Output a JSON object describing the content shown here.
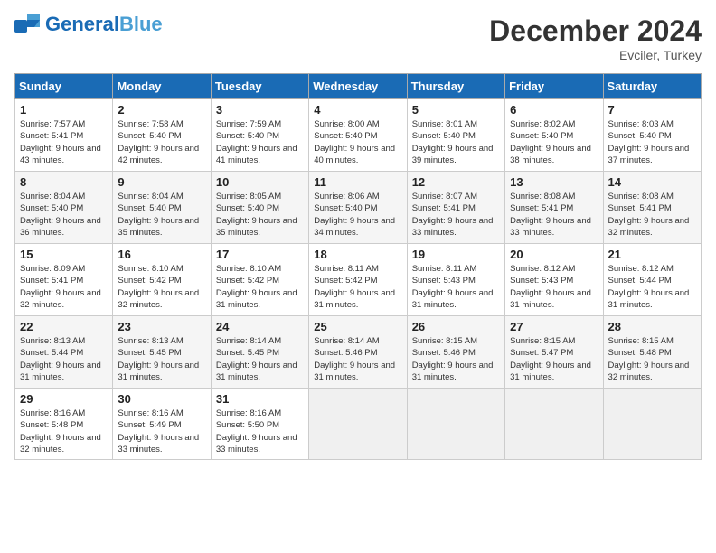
{
  "header": {
    "logo_general": "General",
    "logo_blue": "Blue",
    "month_title": "December 2024",
    "location": "Evciler, Turkey"
  },
  "weekdays": [
    "Sunday",
    "Monday",
    "Tuesday",
    "Wednesday",
    "Thursday",
    "Friday",
    "Saturday"
  ],
  "weeks": [
    [
      {
        "day": "1",
        "sunrise": "7:57 AM",
        "sunset": "5:41 PM",
        "daylight": "9 hours and 43 minutes."
      },
      {
        "day": "2",
        "sunrise": "7:58 AM",
        "sunset": "5:40 PM",
        "daylight": "9 hours and 42 minutes."
      },
      {
        "day": "3",
        "sunrise": "7:59 AM",
        "sunset": "5:40 PM",
        "daylight": "9 hours and 41 minutes."
      },
      {
        "day": "4",
        "sunrise": "8:00 AM",
        "sunset": "5:40 PM",
        "daylight": "9 hours and 40 minutes."
      },
      {
        "day": "5",
        "sunrise": "8:01 AM",
        "sunset": "5:40 PM",
        "daylight": "9 hours and 39 minutes."
      },
      {
        "day": "6",
        "sunrise": "8:02 AM",
        "sunset": "5:40 PM",
        "daylight": "9 hours and 38 minutes."
      },
      {
        "day": "7",
        "sunrise": "8:03 AM",
        "sunset": "5:40 PM",
        "daylight": "9 hours and 37 minutes."
      }
    ],
    [
      {
        "day": "8",
        "sunrise": "8:04 AM",
        "sunset": "5:40 PM",
        "daylight": "9 hours and 36 minutes."
      },
      {
        "day": "9",
        "sunrise": "8:04 AM",
        "sunset": "5:40 PM",
        "daylight": "9 hours and 35 minutes."
      },
      {
        "day": "10",
        "sunrise": "8:05 AM",
        "sunset": "5:40 PM",
        "daylight": "9 hours and 35 minutes."
      },
      {
        "day": "11",
        "sunrise": "8:06 AM",
        "sunset": "5:40 PM",
        "daylight": "9 hours and 34 minutes."
      },
      {
        "day": "12",
        "sunrise": "8:07 AM",
        "sunset": "5:41 PM",
        "daylight": "9 hours and 33 minutes."
      },
      {
        "day": "13",
        "sunrise": "8:08 AM",
        "sunset": "5:41 PM",
        "daylight": "9 hours and 33 minutes."
      },
      {
        "day": "14",
        "sunrise": "8:08 AM",
        "sunset": "5:41 PM",
        "daylight": "9 hours and 32 minutes."
      }
    ],
    [
      {
        "day": "15",
        "sunrise": "8:09 AM",
        "sunset": "5:41 PM",
        "daylight": "9 hours and 32 minutes."
      },
      {
        "day": "16",
        "sunrise": "8:10 AM",
        "sunset": "5:42 PM",
        "daylight": "9 hours and 32 minutes."
      },
      {
        "day": "17",
        "sunrise": "8:10 AM",
        "sunset": "5:42 PM",
        "daylight": "9 hours and 31 minutes."
      },
      {
        "day": "18",
        "sunrise": "8:11 AM",
        "sunset": "5:42 PM",
        "daylight": "9 hours and 31 minutes."
      },
      {
        "day": "19",
        "sunrise": "8:11 AM",
        "sunset": "5:43 PM",
        "daylight": "9 hours and 31 minutes."
      },
      {
        "day": "20",
        "sunrise": "8:12 AM",
        "sunset": "5:43 PM",
        "daylight": "9 hours and 31 minutes."
      },
      {
        "day": "21",
        "sunrise": "8:12 AM",
        "sunset": "5:44 PM",
        "daylight": "9 hours and 31 minutes."
      }
    ],
    [
      {
        "day": "22",
        "sunrise": "8:13 AM",
        "sunset": "5:44 PM",
        "daylight": "9 hours and 31 minutes."
      },
      {
        "day": "23",
        "sunrise": "8:13 AM",
        "sunset": "5:45 PM",
        "daylight": "9 hours and 31 minutes."
      },
      {
        "day": "24",
        "sunrise": "8:14 AM",
        "sunset": "5:45 PM",
        "daylight": "9 hours and 31 minutes."
      },
      {
        "day": "25",
        "sunrise": "8:14 AM",
        "sunset": "5:46 PM",
        "daylight": "9 hours and 31 minutes."
      },
      {
        "day": "26",
        "sunrise": "8:15 AM",
        "sunset": "5:46 PM",
        "daylight": "9 hours and 31 minutes."
      },
      {
        "day": "27",
        "sunrise": "8:15 AM",
        "sunset": "5:47 PM",
        "daylight": "9 hours and 31 minutes."
      },
      {
        "day": "28",
        "sunrise": "8:15 AM",
        "sunset": "5:48 PM",
        "daylight": "9 hours and 32 minutes."
      }
    ],
    [
      {
        "day": "29",
        "sunrise": "8:16 AM",
        "sunset": "5:48 PM",
        "daylight": "9 hours and 32 minutes."
      },
      {
        "day": "30",
        "sunrise": "8:16 AM",
        "sunset": "5:49 PM",
        "daylight": "9 hours and 33 minutes."
      },
      {
        "day": "31",
        "sunrise": "8:16 AM",
        "sunset": "5:50 PM",
        "daylight": "9 hours and 33 minutes."
      },
      null,
      null,
      null,
      null
    ]
  ]
}
